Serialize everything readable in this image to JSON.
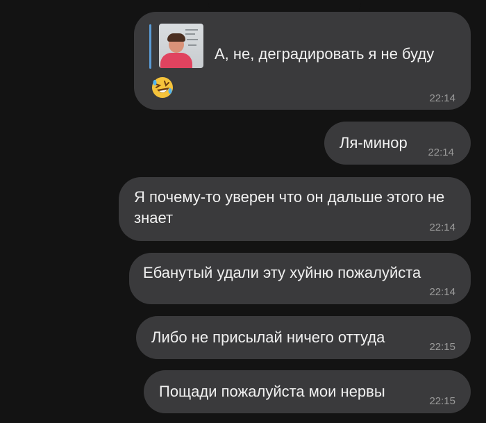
{
  "messages": [
    {
      "reply_text": "А, не, деградировать я не буду",
      "emoji": "rolling-on-floor-laughing",
      "time": "22:14"
    },
    {
      "text": "Ля-минор",
      "time": "22:14"
    },
    {
      "text": "Я почему-то уверен что он дальше этого не знает",
      "time": "22:14"
    },
    {
      "text": "Ебанутый удали эту хуйню пожалуйста",
      "time": "22:14"
    },
    {
      "text": "Либо не присылай ничего оттуда",
      "time": "22:15"
    },
    {
      "text": "Пощади пожалуйста мои нервы",
      "time": "22:15"
    }
  ],
  "colors": {
    "background": "#131313",
    "bubble": "#3a3a3c",
    "reply_bar": "#5b9bd5",
    "time": "#9a9a9a"
  }
}
